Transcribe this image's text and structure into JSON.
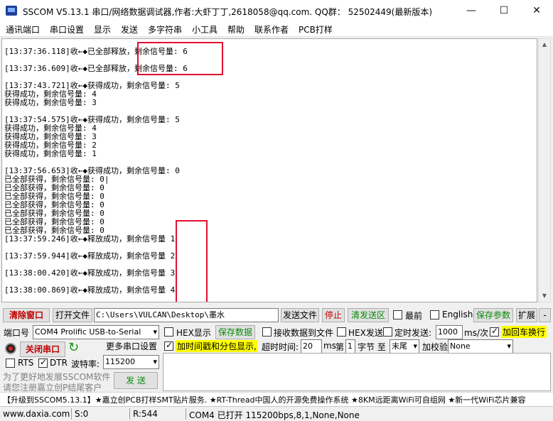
{
  "window": {
    "title": "SSCOM V5.13.1 串口/网络数据调试器,作者:大虾丁丁,2618058@qq.com. QQ群： 52502449(最新版本)"
  },
  "menu": [
    "通讯端口",
    "串口设置",
    "显示",
    "发送",
    "多字符串",
    "小工具",
    "帮助",
    "联系作者",
    "PCB打样"
  ],
  "log": [
    "[13:37:36.118]收←◆已全部释放，剩余信号量: 6",
    "[13:37:36.609]收←◆已全部释放，剩余信号量: 6",
    "[13:37:43.721]收←◆获得成功，剩余信号量: 5",
    "获得成功，剩余信号量: 4",
    "获得成功，剩余信号量: 3",
    "[13:37:54.575]收←◆获得成功，剩余信号量: 5",
    "获得成功，剩余信号量: 4",
    "获得成功，剩余信号量: 3",
    "获得成功，剩余信号量: 2",
    "获得成功，剩余信号量: 1",
    "[13:37:56.653]收←◆获得成功，剩余信号量: 0",
    "已全部获得，剩余信号量: 0|",
    "已全部获得，剩余信号量: 0",
    "已全部获得，剩余信号量: 0",
    "已全部获得，剩余信号量: 0",
    "已全部获得，剩余信号量: 0",
    "已全部获得，剩余信号量: 0",
    "已全部获得，剩余信号量: 0",
    "[13:37:59.246]收←◆释放成功，剩余信号量  1",
    "[13:37:59.944]收←◆释放成功，剩余信号量  2",
    "[13:38:00.420]收←◆释放成功，剩余信号量  3",
    "[13:38:00.869]收←◆释放成功，剩余信号量  4"
  ],
  "toolbar": {
    "clear": "清除窗口",
    "open_file": "打开文件",
    "file_path": "C:\\Users\\VULCAN\\Desktop\\墨水",
    "send_file": "发送文件",
    "stop": "停止",
    "clear_send": "清发送区",
    "topmost": "最前",
    "english": "English",
    "save_params": "保存参数",
    "expand": "扩展",
    "collapse": "-"
  },
  "port": {
    "label": "端口号",
    "value": "COM4 Prolific USB-to-Serial",
    "close_button": "关闭串口",
    "more_settings": "更多串口设置",
    "rts": "RTS",
    "dtr": "DTR",
    "baud_label": "波特率:",
    "baud": "115200"
  },
  "options": {
    "hex_display": "HEX显示",
    "save_data": "保存数据",
    "recv_to_file": "接收数据到文件",
    "hex_send": "HEX发送",
    "timed_send": "定时发送:",
    "interval": "1000",
    "interval_unit": "ms/次",
    "append_crlf": "加回车换行",
    "timestamp": "加时间戳和分包显示,",
    "timeout_label": "超时时间:",
    "timeout": "20",
    "ms": "ms",
    "byte_index_prefix": "第",
    "byte_index": "1",
    "byte_to": "字节 至",
    "byte_end": "末尾",
    "checksum_label": "加校验",
    "checksum": "None"
  },
  "promo": {
    "line1": "为了更好地发展SSCOM软件",
    "line2": "请您注册嘉立创P结尾客户"
  },
  "send_button": "发 送",
  "ads": "【升级到SSCOM5.13.1】★嘉立创PCB打样SMT贴片服务. ★RT-Thread中国人的开源免费操作系统 ★8KM远距离WiFi可自组网 ★新一代WiFi芯片兼容",
  "status": {
    "site": "www.daxia.com",
    "sent": "S:0",
    "received": "R:544",
    "port_status": "COM4 已打开  115200bps,8,1,None,None"
  }
}
